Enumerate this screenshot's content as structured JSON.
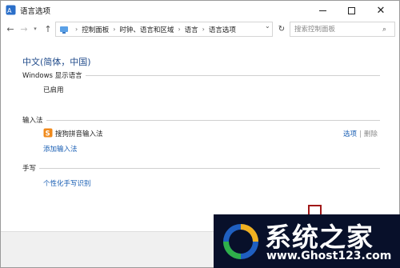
{
  "window": {
    "title": "语言选项",
    "close_glyph": "✕"
  },
  "nav": {
    "back_glyph": "←",
    "forward_glyph": "→",
    "recent_glyph": "▾",
    "up_glyph": "↑",
    "refresh_glyph": "↻",
    "breadcrumb": [
      "控制面板",
      "时钟、语言和区域",
      "语言",
      "语言选项"
    ],
    "breadcrumb_sep": "›",
    "dropdown_glyph": "⌄"
  },
  "search": {
    "placeholder": "搜索控制面板",
    "icon": "search-icon",
    "glyph": "⌕"
  },
  "language": {
    "heading": "中文(简体，中国)"
  },
  "display_language": {
    "title": "Windows 显示语言",
    "status": "已启用"
  },
  "input_method": {
    "title": "输入法",
    "items": [
      {
        "name": "搜狗拼音输入法",
        "options_label": "选项",
        "separator": "|",
        "remove_label": "删除"
      }
    ],
    "add_label": "添加输入法"
  },
  "handwriting": {
    "title": "手写",
    "personalize_label": "个性化手写识别"
  },
  "watermark": {
    "title": "系统之家",
    "url": "www.Ghost123.com"
  },
  "colors": {
    "heading": "#1f4a8a",
    "link": "#1a5fb4",
    "watermark_bg": "#08102a",
    "accent_red": "#a01818"
  }
}
